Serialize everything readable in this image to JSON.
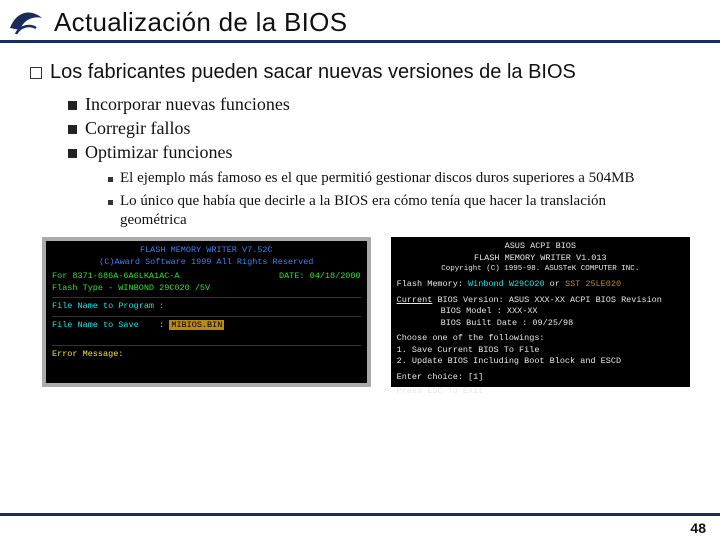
{
  "title": "Actualización de la BIOS",
  "main_bullet": "Los fabricantes pueden sacar nuevas versiones de la BIOS",
  "sub_bullets": [
    "Incorporar nuevas funciones",
    "Corregir fallos",
    "Optimizar funciones"
  ],
  "sub_sub_bullets": [
    "El ejemplo más famoso es el que permitió gestionar discos duros superiores a 504MB",
    "Lo único que había que decirle a la BIOS era cómo tenía que hacer la translación geométrica"
  ],
  "term_left": {
    "title1": "FLASH MEMORY WRITER V7.52C",
    "title2": "(C)Award Software 1999 All Rights Reserved",
    "line1a": "For 8371-686A-6A6LKA1AC-A",
    "line1b": "DATE: 04/18/2000",
    "line2": "Flash Type - WINBOND 29C020 /5V",
    "label1": "File Name to Program :",
    "label2": "File Name to Save",
    "value2": "MIBIOS.BIN",
    "err": "Error Message:"
  },
  "term_right": {
    "h1": "ASUS ACPI BIOS",
    "h2": "FLASH MEMORY WRITER V1.013",
    "h3": "Copyright (C) 1995-98. ASUSTeK COMPUTER INC.",
    "flash_label": "Flash Memory:",
    "flash_v1": "Winbond W29CO20",
    "flash_or": "or",
    "flash_v2": "SST 25LE020",
    "cur_label": "Current",
    "cur_line1": "BIOS Version: ASUS XXX-XX ACPI BIOS Revision",
    "cur_line2": "BIOS Model   : XXX-XX",
    "cur_line3": "BIOS Built Date  : 09/25/98",
    "choose": "Choose one of the followings:",
    "opt1": "1. Save Current BIOS To File",
    "opt2": "2. Update BIOS Including Boot Block and ESCD",
    "enter": "Enter choice: [1]",
    "esc": "Press ESC To Exit"
  },
  "page_number": "48"
}
